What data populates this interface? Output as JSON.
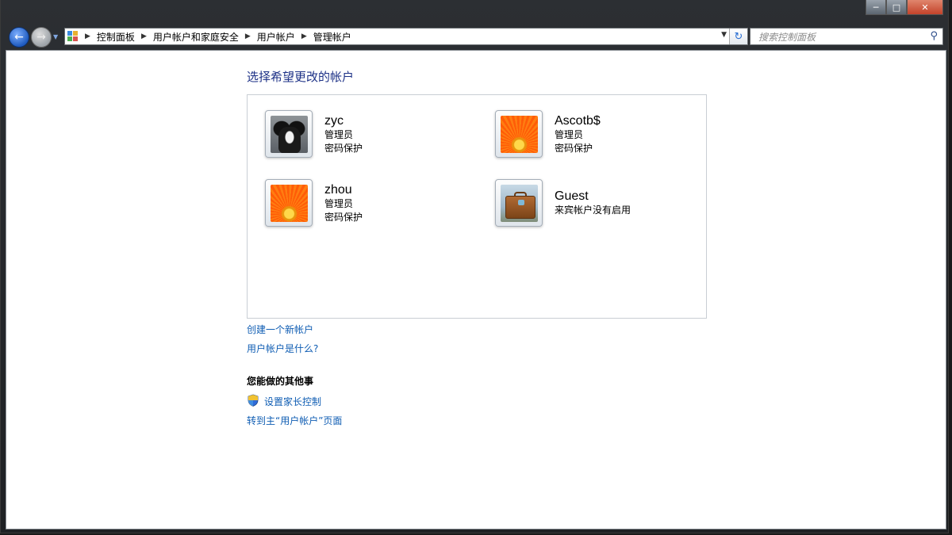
{
  "window": {
    "caption": {
      "minimize": "─",
      "maximize": "□",
      "close": "✕"
    }
  },
  "navigation": {
    "back_icon": "back-arrow-icon",
    "forward_icon": "forward-arrow-icon",
    "breadcrumbs": [
      "控制面板",
      "用户帐户和家庭安全",
      "用户帐户",
      "管理帐户"
    ],
    "search_placeholder": "搜索控制面板"
  },
  "main": {
    "title": "选择希望更改的帐户",
    "accounts": [
      {
        "name": "zyc",
        "role": "管理员",
        "status": "密码保护",
        "picture": "dog"
      },
      {
        "name": "Ascotb$",
        "role": "管理员",
        "status": "密码保护",
        "picture": "flower"
      },
      {
        "name": "zhou",
        "role": "管理员",
        "status": "密码保护",
        "picture": "flower"
      },
      {
        "name": "Guest",
        "role": "来宾帐户没有启用",
        "status": "",
        "picture": "suitcase"
      }
    ],
    "links": {
      "create_account": "创建一个新帐户",
      "what_is_account": "用户帐户是什么?"
    },
    "other_tasks": {
      "heading": "您能做的其他事",
      "parental_controls": "设置家长控制",
      "go_main": "转到主“用户帐户”页面"
    }
  },
  "colors": {
    "title": "#1e3287",
    "link": "#0f5db3"
  }
}
